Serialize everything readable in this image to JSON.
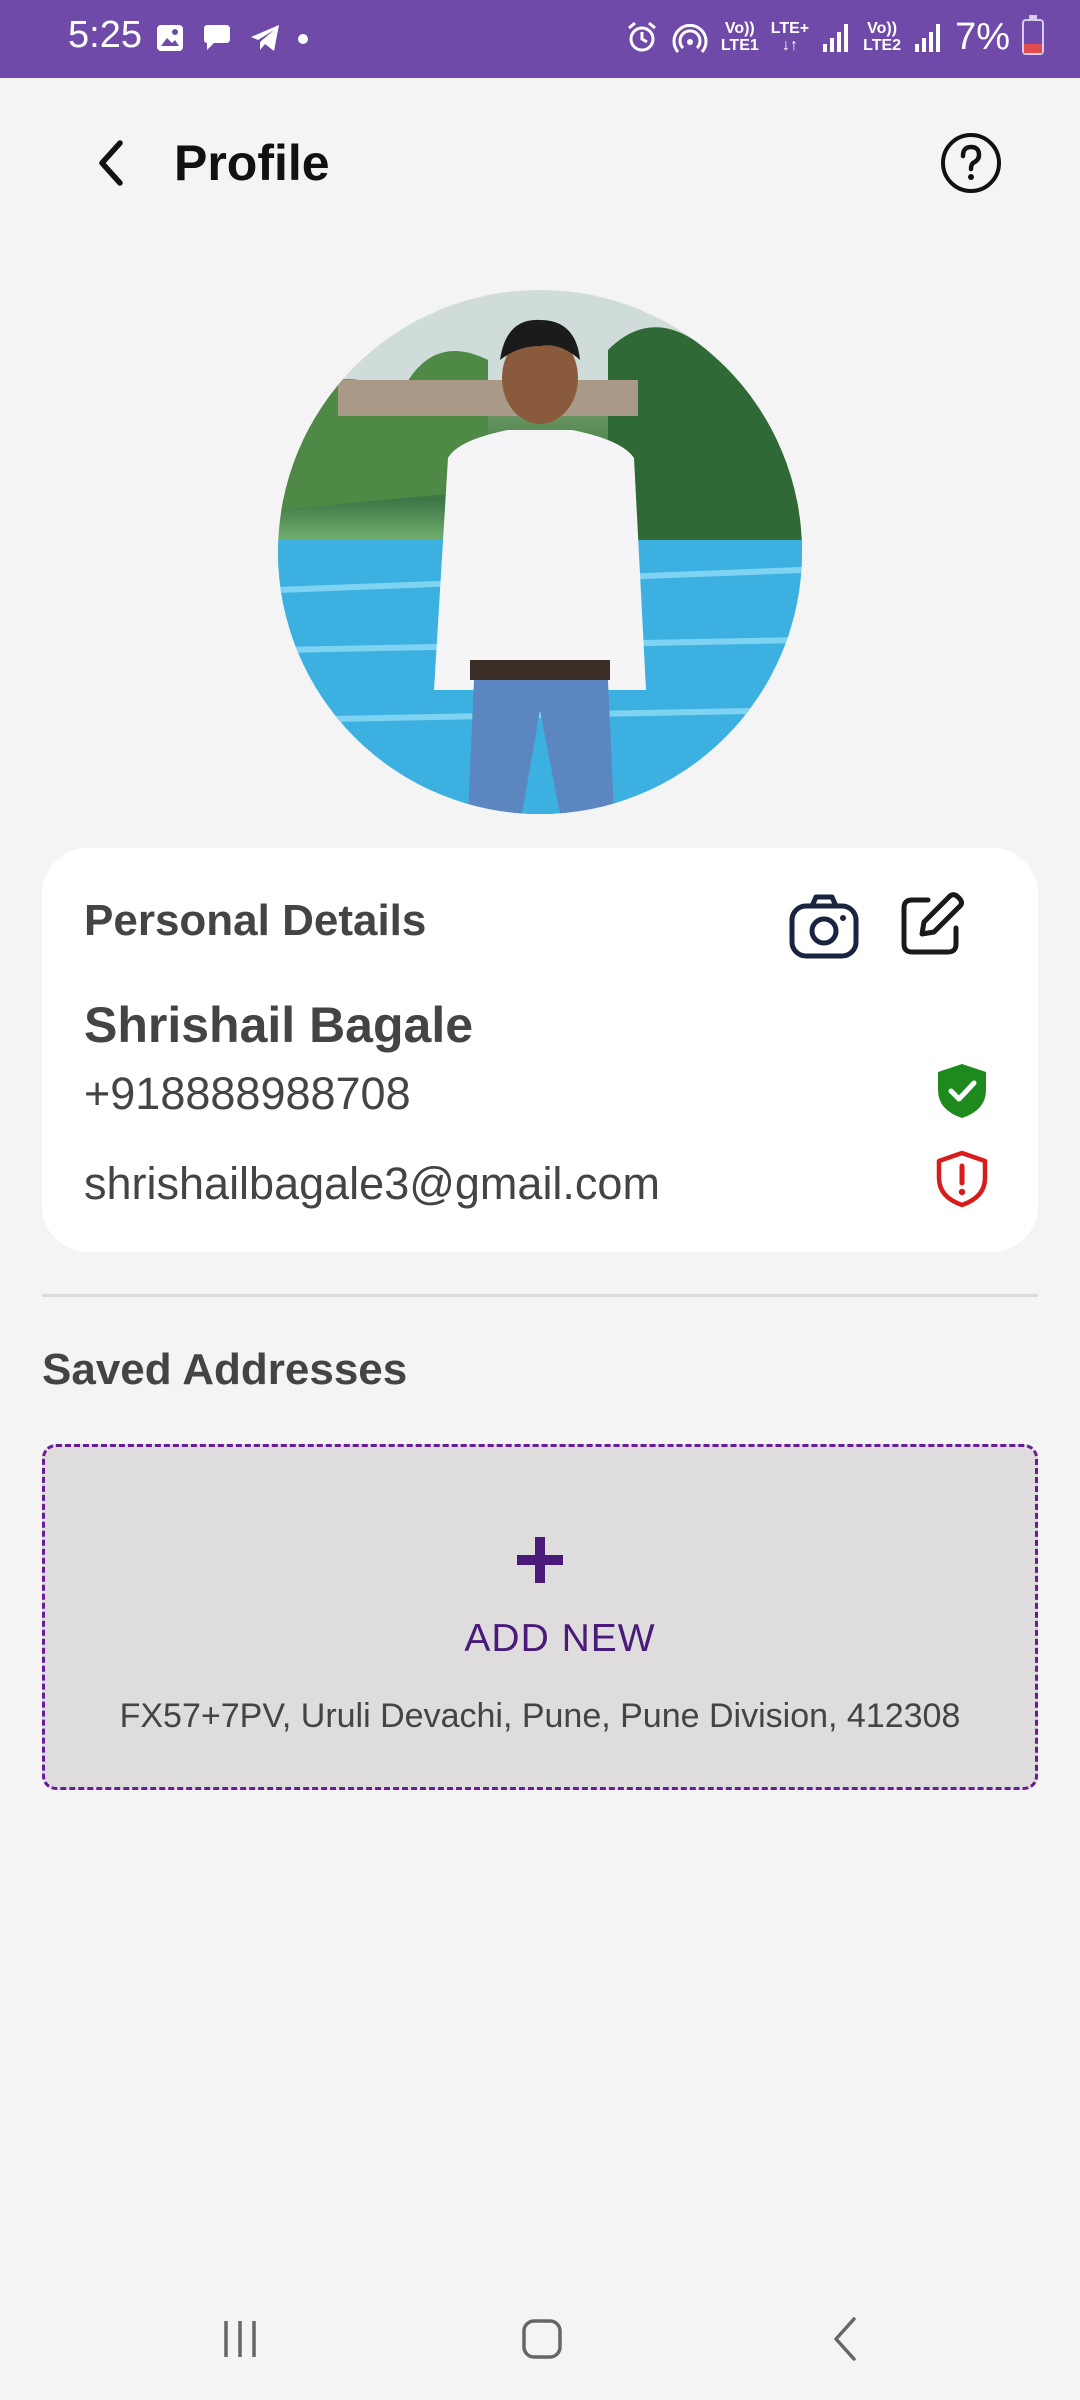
{
  "status_bar": {
    "time": "5:25",
    "network_1": [
      "Vo))",
      "LTE1"
    ],
    "network_lte": "LTE+",
    "network_2": [
      "Vo))",
      "LTE2"
    ],
    "battery_percent": "7%",
    "battery_level": 0.07,
    "colors": {
      "background": "#6f4aa8",
      "battery_low": "#e24b4b"
    }
  },
  "header": {
    "title": "Profile",
    "back_icon": "chevron-left-icon",
    "help_icon": "help-circle-icon"
  },
  "avatar": {
    "description_icon": "profile-photo"
  },
  "personal_details": {
    "title": "Personal Details",
    "camera_icon": "camera-icon",
    "edit_icon": "edit-icon",
    "name": "Shrishail Bagale",
    "phone": "+918888988708",
    "phone_status_icon": "verified-shield-icon",
    "email": "shrishailbagale3@gmail.com",
    "email_status_icon": "unverified-shield-icon",
    "colors": {
      "verified": "#1e8a1e",
      "unverified": "#d81b1b"
    }
  },
  "saved_addresses": {
    "title": "Saved Addresses",
    "add_new_label": "ADD NEW",
    "address": "FX57+7PV, Uruli Devachi, Pune, Pune Division, 412308",
    "colors": {
      "accent": "#4a1a7a",
      "border": "#6a1b9a"
    }
  },
  "nav_bar": {
    "recents_icon": "recents-icon",
    "home_icon": "home-icon",
    "back_icon": "back-icon"
  }
}
